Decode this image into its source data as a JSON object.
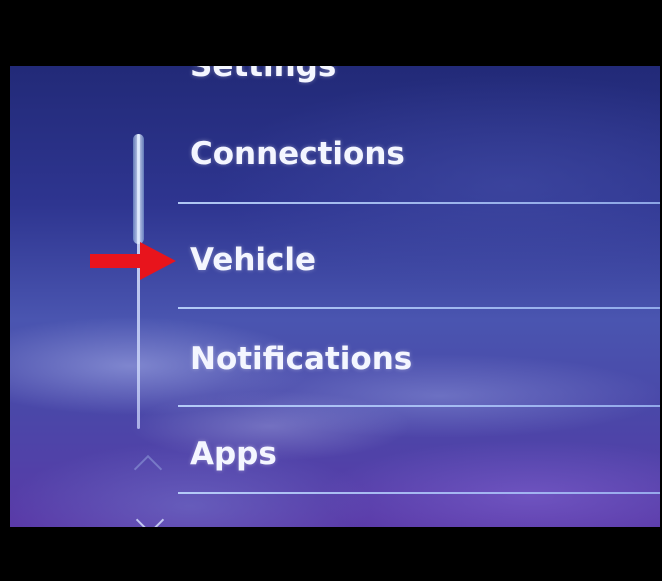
{
  "menu": {
    "partial_label": "Settings",
    "items": [
      {
        "label": "Connections"
      },
      {
        "label": "Vehicle"
      },
      {
        "label": "Notifications"
      },
      {
        "label": "Apps"
      }
    ]
  },
  "scroll": {
    "up_icon": "chevron-up-icon",
    "down_icon": "chevron-down-icon"
  },
  "annotation": {
    "pointer_icon": "red-arrow-icon",
    "color": "#e8141c",
    "points_to": "Vehicle"
  },
  "colors": {
    "text": "#f4f6ff",
    "divider": "#bcd4ff",
    "scrollbar": "#dce6ff"
  }
}
